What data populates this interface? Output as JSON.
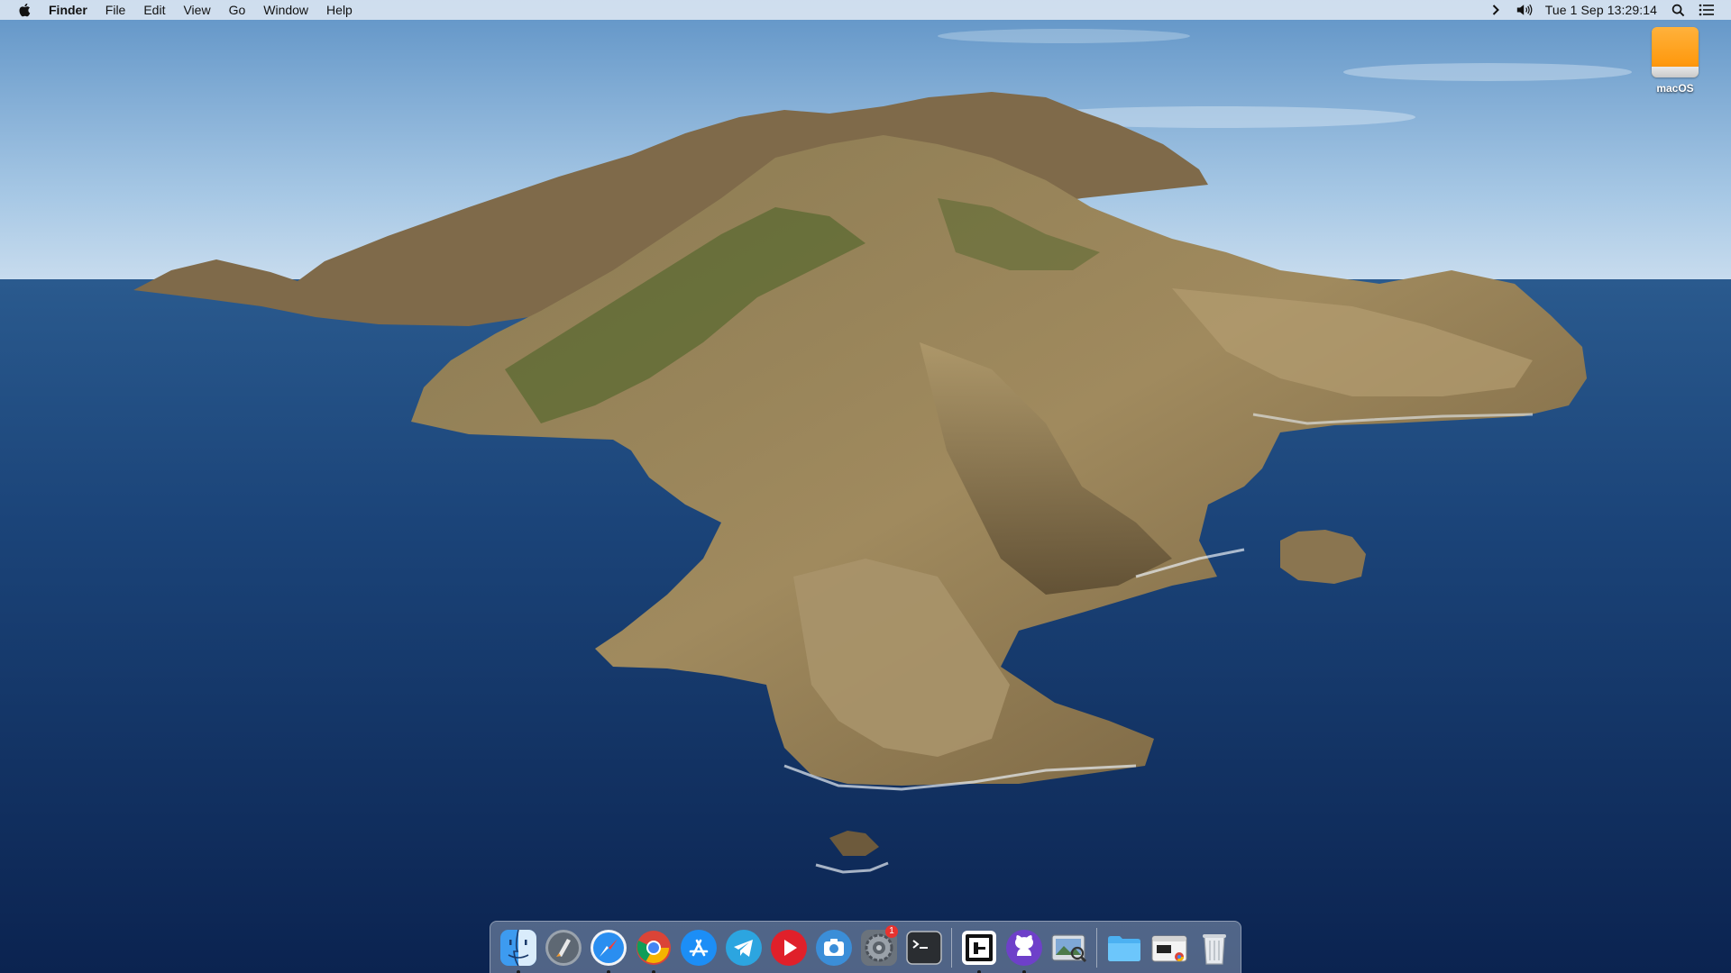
{
  "menubar": {
    "app_name": "Finder",
    "items": [
      "File",
      "Edit",
      "View",
      "Go",
      "Window",
      "Help"
    ],
    "status_icons": [
      "chevron-right-icon",
      "volume-icon"
    ],
    "clock": "Tue 1 Sep  13:29:14",
    "right_icons": [
      "spotlight-search-icon",
      "notification-center-icon"
    ]
  },
  "desktop": {
    "drive_label": "macOS"
  },
  "dock": {
    "apps": [
      {
        "name": "finder-icon",
        "running": true
      },
      {
        "name": "launchpad-icon",
        "running": false
      },
      {
        "name": "safari-icon",
        "running": true
      },
      {
        "name": "chrome-icon",
        "running": true
      },
      {
        "name": "app-store-icon",
        "running": false
      },
      {
        "name": "telegram-icon",
        "running": false
      },
      {
        "name": "media-player-icon",
        "running": false
      },
      {
        "name": "screenshot-icon",
        "running": false
      },
      {
        "name": "system-preferences-icon",
        "running": false,
        "badge": "1"
      },
      {
        "name": "terminal-icon",
        "running": false
      },
      {
        "name": "code-editor-icon",
        "running": true
      },
      {
        "name": "github-desktop-icon",
        "running": true
      },
      {
        "name": "preview-icon",
        "running": false
      },
      {
        "name": "folder-icon",
        "running": false
      },
      {
        "name": "finder-window-icon",
        "running": false
      },
      {
        "name": "trash-icon",
        "running": false
      }
    ]
  }
}
